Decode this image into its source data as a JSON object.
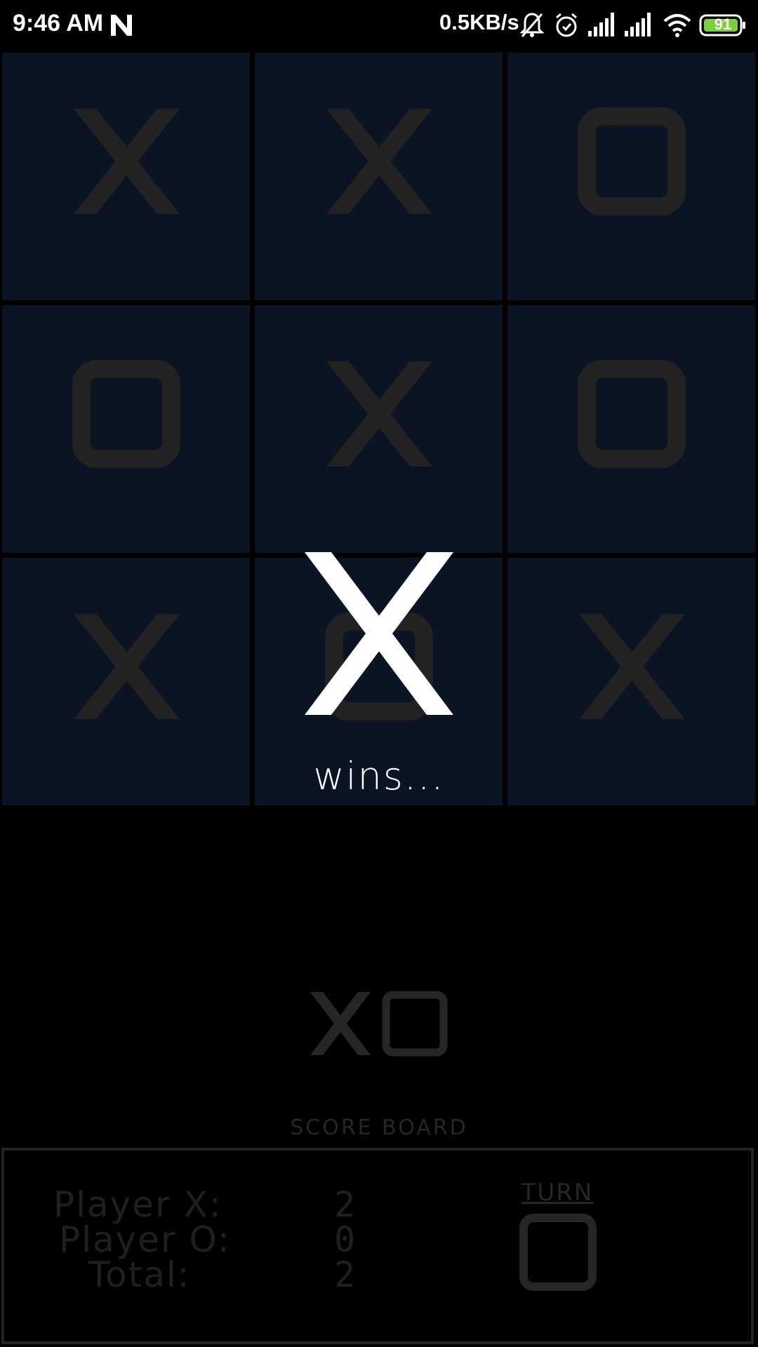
{
  "status_bar": {
    "time": "9:46 AM",
    "net_speed": "0.5KB/s",
    "battery": "91",
    "icons": [
      "n-icon",
      "mute-icon",
      "alarm-icon",
      "signal-icon",
      "signal-icon",
      "wifi-icon",
      "battery-icon"
    ]
  },
  "board": {
    "cells": [
      "X",
      "X",
      "O",
      "O",
      "X",
      "O",
      "X",
      "O",
      "X"
    ]
  },
  "result": {
    "winner": "X",
    "message": "wins..."
  },
  "logo": {
    "text": "XO"
  },
  "score": {
    "title": "SCORE BOARD",
    "rows": [
      {
        "label": "Player X:",
        "value": "2"
      },
      {
        "label": "Player O:",
        "value": "0"
      },
      {
        "label": "Total:",
        "value": "2"
      }
    ],
    "turn_label": "TURN",
    "turn_mark": "O"
  },
  "colors": {
    "cell_bg": "#0b1423",
    "mark": "#222222",
    "overlay": "#ffffff",
    "accent_battery": "#7bd13d"
  }
}
